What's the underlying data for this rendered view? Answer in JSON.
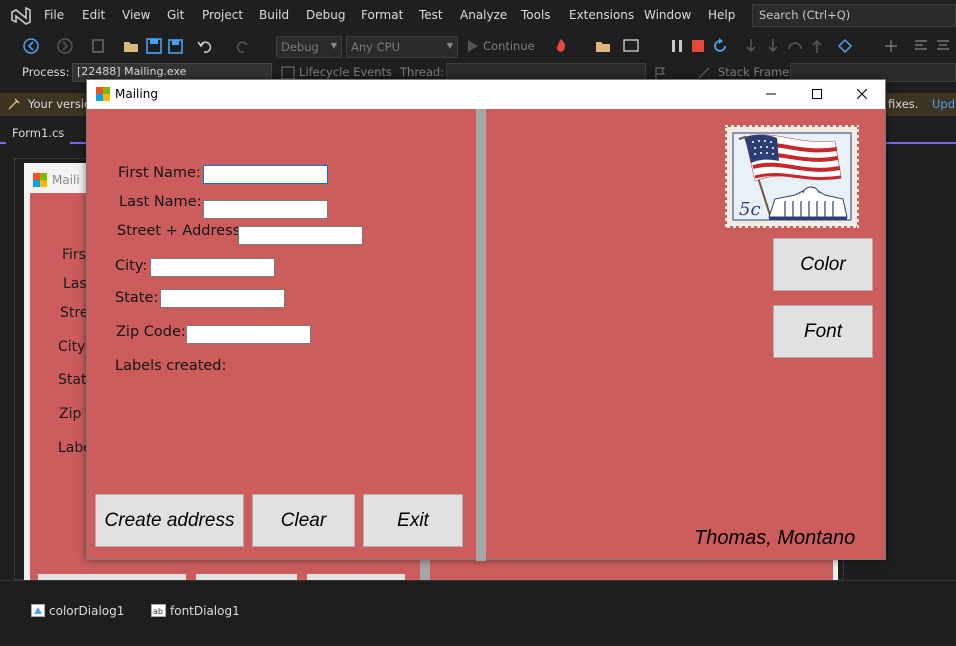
{
  "menu": {
    "items": [
      "File",
      "Edit",
      "View",
      "Git",
      "Project",
      "Build",
      "Debug",
      "Format",
      "Test",
      "Analyze",
      "Tools",
      "Extensions",
      "Window",
      "Help"
    ],
    "search_placeholder": "Search (Ctrl+Q)"
  },
  "toolbar": {
    "config": "Debug",
    "platform": "Any CPU",
    "continue_label": "Continue"
  },
  "debugbar": {
    "process_label": "Process:",
    "process_value": "[22488] Mailing.exe",
    "lifecycle_label": "Lifecycle Events",
    "thread_label": "Thread:",
    "stack_label": "Stack Frame:"
  },
  "infobar": {
    "text": "Your versio",
    "trailing": "fixes.",
    "link": "Upd"
  },
  "tabs": {
    "active": "Form1.cs"
  },
  "background_form": {
    "title": "Maili",
    "labels": [
      "Firs",
      "Las",
      "Stre",
      "City",
      "Stat",
      "Zip",
      "Labe"
    ]
  },
  "mailing": {
    "title": "Mailing",
    "labels": {
      "first_name": "First Name:",
      "last_name": "Last Name:",
      "street": "Street + Address:",
      "city": "City:",
      "state": "State:",
      "zip": "Zip Code:",
      "labels_created": "Labels created:"
    },
    "inputs": {
      "first_name": "",
      "last_name": "",
      "street": "",
      "city": "",
      "state": "",
      "zip": ""
    },
    "buttons": {
      "create": "Create address",
      "clear": "Clear",
      "exit": "Exit",
      "color": "Color",
      "font": "Font"
    },
    "signature": "Thomas, Montano",
    "stamp_value": "5c"
  },
  "component_tray": {
    "items": [
      "colorDialog1",
      "fontDialog1"
    ]
  },
  "colors": {
    "form_back": "#cd5c5c",
    "vs_bg": "#1f1f1f",
    "accent": "#7b68ee"
  }
}
